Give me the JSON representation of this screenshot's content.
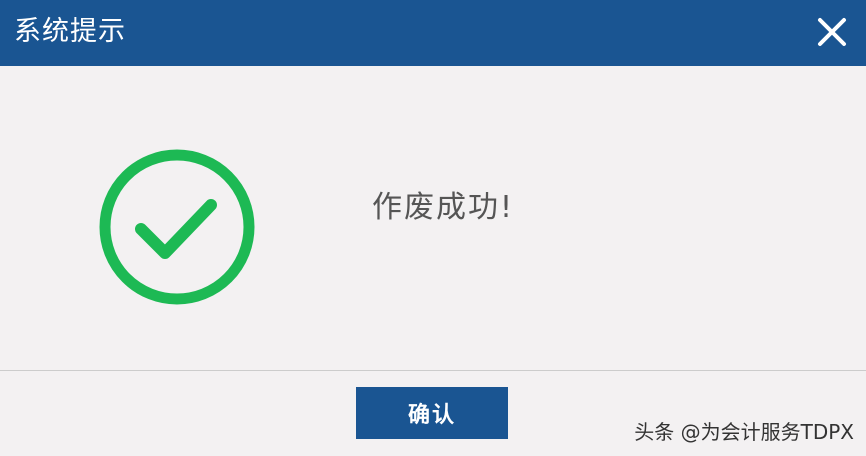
{
  "dialog": {
    "title": "系统提示",
    "close_icon": "close-icon",
    "message": "作废成功!",
    "status_icon": "check-circle-icon",
    "confirm_label": "确认"
  },
  "watermark": {
    "text": "头条 @为会计服务TDPX"
  },
  "colors": {
    "titlebar": "#1a5592",
    "success": "#1db954",
    "background": "#f3f1f2",
    "button": "#1a5592"
  }
}
